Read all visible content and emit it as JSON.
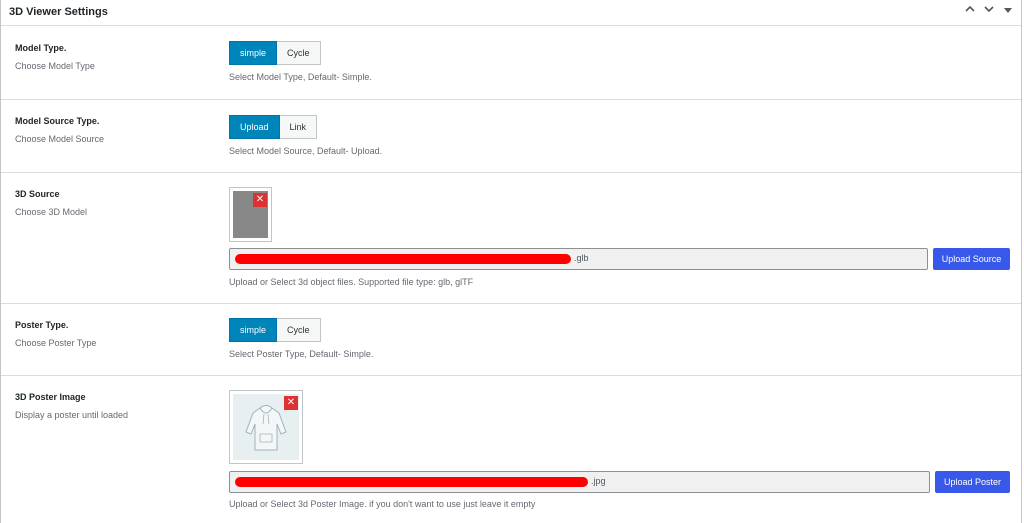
{
  "panel": {
    "title": "3D Viewer Settings",
    "icons": {
      "collapse_up": "chevron-up-icon",
      "collapse_down": "chevron-down-icon",
      "toggle": "triangle-down-icon"
    }
  },
  "model_type": {
    "label": "Model Type.",
    "sublabel": "Choose Model Type",
    "options": [
      "simple",
      "Cycle"
    ],
    "selected": "simple",
    "hint": "Select Model Type, Default- Simple."
  },
  "model_source_type": {
    "label": "Model Source Type.",
    "sublabel": "Choose Model Source",
    "options": [
      "Upload",
      "Link"
    ],
    "selected": "Upload",
    "hint": "Select Model Source, Default- Upload."
  },
  "source_3d": {
    "label": "3D Source",
    "sublabel": "Choose 3D Model",
    "remove_icon": "close-icon",
    "file_suffix": ".glb",
    "upload_label": "Upload Source",
    "hint": "Upload or Select 3d object files. Supported file type: glb, glTF"
  },
  "poster_type": {
    "label": "Poster Type.",
    "sublabel": "Choose Poster Type",
    "options": [
      "simple",
      "Cycle"
    ],
    "selected": "simple",
    "hint": "Select Poster Type, Default- Simple."
  },
  "poster_image": {
    "label": "3D Poster Image",
    "sublabel": "Display a poster until loaded",
    "remove_icon": "close-icon",
    "file_suffix": ".jpg",
    "upload_label": "Upload Poster",
    "hint": "Upload or Select 3d Poster Image. if you don't want to use just leave it empty"
  },
  "colors": {
    "active": "#0085ba",
    "upload": "#3858e9",
    "remove": "#dc3232",
    "redaction": "#ff0000"
  }
}
